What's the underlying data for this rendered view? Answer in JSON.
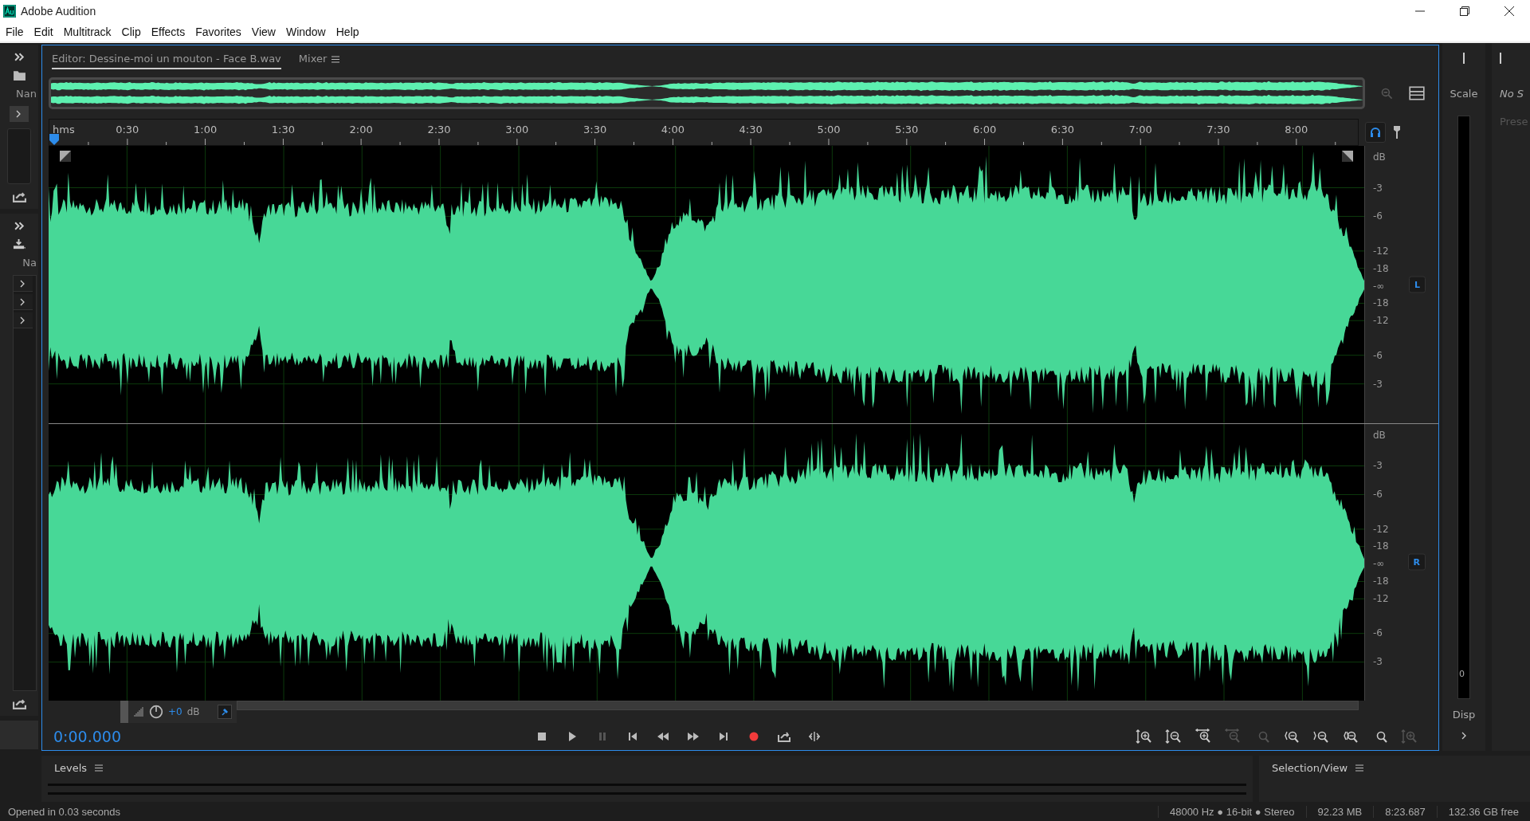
{
  "window": {
    "title": "Adobe Audition"
  },
  "menu": [
    "File",
    "Edit",
    "Multitrack",
    "Clip",
    "Effects",
    "Favorites",
    "View",
    "Window",
    "Help"
  ],
  "tabs": [
    {
      "label": "Editor: Dessine-moi un mouton - Face B.wav",
      "selected": true
    },
    {
      "label": "Mixer",
      "selected": false
    }
  ],
  "left_panels": [
    {
      "label": "Nan"
    },
    {
      "label": "Na"
    }
  ],
  "ruler": {
    "unit": "hms",
    "labels": [
      "0:30",
      "1:00",
      "1:30",
      "2:00",
      "2:30",
      "3:00",
      "3:30",
      "4:00",
      "4:30",
      "5:00",
      "5:30",
      "6:00",
      "6:30",
      "7:00",
      "7:30",
      "8:00"
    ]
  },
  "channels": [
    {
      "badge": "L",
      "scale": [
        "dB",
        "-3",
        "-6",
        "-12",
        "-18",
        "-∞",
        "-18",
        "-12",
        "-6",
        "-3"
      ]
    },
    {
      "badge": "R",
      "scale": [
        "dB",
        "-3",
        "-6",
        "-12",
        "-18",
        "-∞",
        "-18",
        "-12",
        "-6",
        "-3"
      ]
    }
  ],
  "hud": {
    "gain": "+0",
    "unit": "dB"
  },
  "time": "0:00.000",
  "transport": [
    {
      "kind": "stop",
      "disabled": false
    },
    {
      "kind": "play",
      "disabled": false
    },
    {
      "kind": "pause",
      "disabled": true
    },
    {
      "kind": "start",
      "disabled": false
    },
    {
      "kind": "rewind",
      "disabled": false
    },
    {
      "kind": "forward",
      "disabled": false
    },
    {
      "kind": "end",
      "disabled": false
    },
    {
      "kind": "record",
      "disabled": false
    },
    {
      "kind": "loop",
      "disabled": false
    },
    {
      "kind": "skip",
      "disabled": false
    }
  ],
  "zoom_tools": [
    {
      "kind": "in-v",
      "disabled": false
    },
    {
      "kind": "out-v",
      "disabled": false
    },
    {
      "kind": "in-h",
      "disabled": false
    },
    {
      "kind": "out-h",
      "disabled": true
    },
    {
      "kind": "full",
      "disabled": true
    },
    {
      "kind": "in-left",
      "disabled": false
    },
    {
      "kind": "in-right",
      "disabled": false
    },
    {
      "kind": "selection",
      "disabled": false
    },
    {
      "kind": "timer",
      "disabled": false
    },
    {
      "kind": "in-v",
      "disabled": true
    }
  ],
  "right_panels": [
    {
      "title": "Scale",
      "meter_label": "0",
      "footer": "Disp"
    },
    {
      "title": "No S",
      "hint": "Prese"
    }
  ],
  "bottom_panels": [
    {
      "title": "Levels"
    },
    {
      "title": "Selection/View"
    }
  ],
  "status": {
    "message": "Opened in 0.03 seconds",
    "format": "48000 Hz ● 16-bit ● Stereo",
    "size": "92.23 MB",
    "duration": "8:23.687",
    "free": "132.36 GB free"
  }
}
